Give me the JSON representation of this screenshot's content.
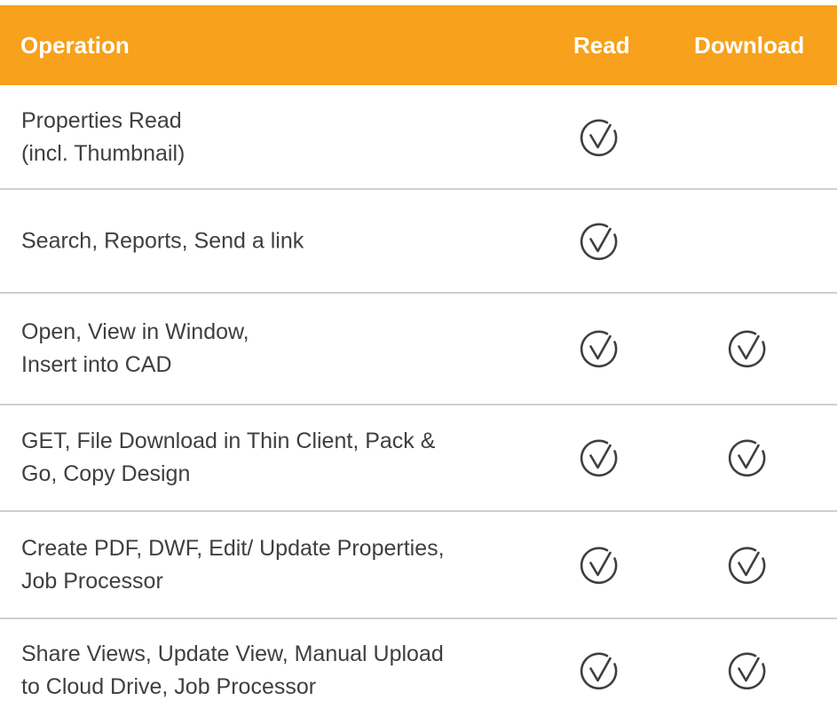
{
  "header": {
    "operation": "Operation",
    "read": "Read",
    "download": "Download"
  },
  "colors": {
    "header_bg": "#f7a11c",
    "header_text": "#ffffff",
    "body_text": "#3f3f3f",
    "divider": "#cfcfcf"
  },
  "rows": [
    {
      "operation": "Properties Read\n(incl. Thumbnail)",
      "read": true,
      "download": false
    },
    {
      "operation": "Search, Reports, Send a link",
      "read": true,
      "download": false
    },
    {
      "operation": "Open, View in Window,\nInsert into CAD",
      "read": true,
      "download": true
    },
    {
      "operation": "GET, File Download in Thin Client, Pack &\nGo, Copy Design",
      "read": true,
      "download": true
    },
    {
      "operation": "Create PDF, DWF, Edit/ Update Properties,\nJob Processor",
      "read": true,
      "download": true
    },
    {
      "operation": "Share Views, Update View, Manual Upload\nto Cloud Drive, Job Processor",
      "read": true,
      "download": true
    }
  ]
}
